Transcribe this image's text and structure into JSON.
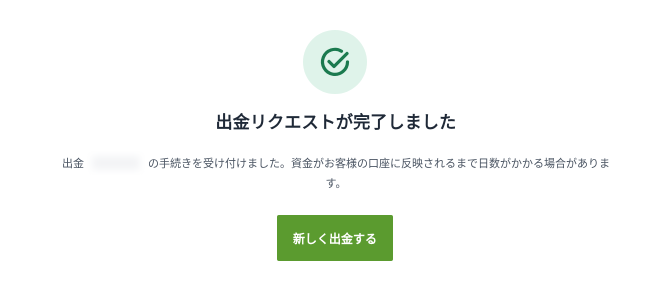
{
  "success": {
    "icon": "check-circle-icon",
    "icon_color": "#1b7a4f",
    "icon_bg": "#dff3ea"
  },
  "title": "出金リクエストが完了しました",
  "message": {
    "prefix": "出金",
    "amount": "",
    "suffix": "の手続きを受け付けました。資金がお客様の口座に反映されるまで日数がかかる場合がありま\nす。"
  },
  "button": {
    "label": "新しく出金する",
    "color": "#5b9b2f"
  }
}
